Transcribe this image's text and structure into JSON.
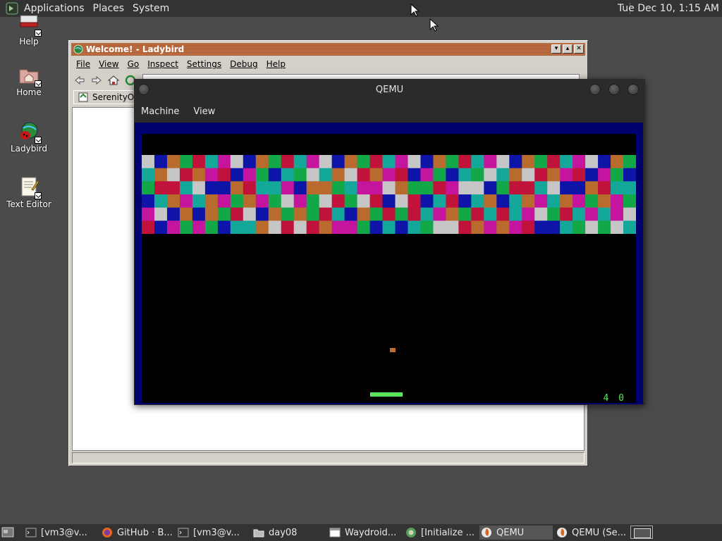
{
  "top_panel": {
    "menus": [
      "Applications",
      "Places",
      "System"
    ],
    "clock": "Tue Dec 10,  1:15 AM"
  },
  "desktop_icons": [
    {
      "label": "Help",
      "icon": "help-book-icon"
    },
    {
      "label": "Home",
      "icon": "home-folder-icon"
    },
    {
      "label": "Ladybird",
      "icon": "ladybird-globe-icon"
    },
    {
      "label": "Text Editor",
      "icon": "text-editor-icon"
    }
  ],
  "ladybird": {
    "title": "Welcome! - Ladybird",
    "menus": [
      "File",
      "View",
      "Go",
      "Inspect",
      "Settings",
      "Debug",
      "Help"
    ],
    "tab_label": "SerenityOS",
    "window_buttons": [
      "▾",
      "▴",
      "✕"
    ]
  },
  "qemu": {
    "title": "QEMU",
    "menus": [
      "Machine",
      "View"
    ],
    "score": "4 0"
  },
  "game": {
    "brick_columns": 39,
    "brick_rows": 6,
    "palette": [
      "#c6c6c6",
      "#b86b2c",
      "#c0123a",
      "#c5149e",
      "#0e14a8",
      "#12a848",
      "#13a89a"
    ]
  },
  "taskbar": {
    "items": [
      {
        "label": "[vm3@v...",
        "icon": "terminal-icon",
        "active": false
      },
      {
        "label": "GitHub · B...",
        "icon": "firefox-icon",
        "active": false
      },
      {
        "label": "[vm3@v...",
        "icon": "terminal-icon",
        "active": false
      },
      {
        "label": "day08",
        "icon": "folder-icon",
        "active": false
      },
      {
        "label": "Waydroid...",
        "icon": "window-icon",
        "active": false
      },
      {
        "label": "[Initialize ...",
        "icon": "app-icon",
        "active": false
      },
      {
        "label": "QEMU",
        "icon": "qemu-icon",
        "active": true
      },
      {
        "label": "QEMU (Se...",
        "icon": "qemu-icon",
        "active": false
      }
    ]
  }
}
